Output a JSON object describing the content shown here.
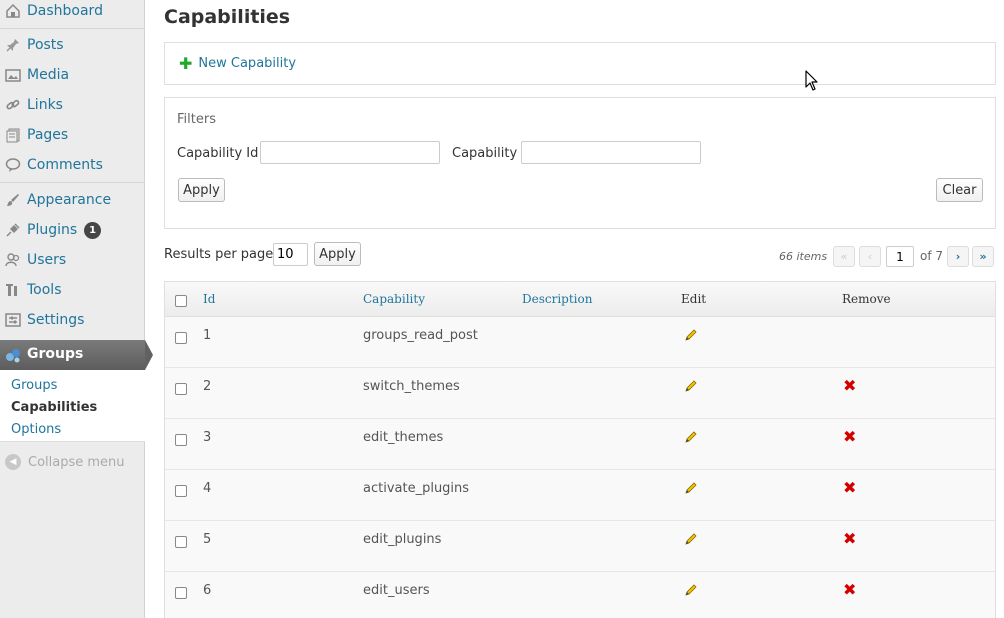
{
  "sidebar": {
    "menu": [
      {
        "key": "dashboard",
        "label": "Dashboard",
        "icon": "dashboard-icon"
      },
      {
        "key": "posts",
        "label": "Posts",
        "icon": "pin-icon"
      },
      {
        "key": "media",
        "label": "Media",
        "icon": "media-icon"
      },
      {
        "key": "links",
        "label": "Links",
        "icon": "link-icon"
      },
      {
        "key": "pages",
        "label": "Pages",
        "icon": "pages-icon"
      },
      {
        "key": "comments",
        "label": "Comments",
        "icon": "comment-bubble-icon"
      },
      {
        "key": "appearance",
        "label": "Appearance",
        "icon": "paintbrush-icon"
      },
      {
        "key": "plugins",
        "label": "Plugins",
        "icon": "plug-icon",
        "badge": "1"
      },
      {
        "key": "users",
        "label": "Users",
        "icon": "users-icon"
      },
      {
        "key": "tools",
        "label": "Tools",
        "icon": "tools-icon"
      },
      {
        "key": "settings",
        "label": "Settings",
        "icon": "settings-icon"
      }
    ],
    "active": {
      "label": "Groups",
      "icon": "groups-icon"
    },
    "submenu": [
      {
        "label": "Groups",
        "current": false
      },
      {
        "label": "Capabilities",
        "current": true
      },
      {
        "label": "Options",
        "current": false
      }
    ],
    "collapse_label": "Collapse menu"
  },
  "main": {
    "title": "Capabilities",
    "new_capability_label": "New Capability",
    "filters": {
      "title": "Filters",
      "capability_id_label": "Capability Id",
      "capability_id_value": "",
      "capability_label": "Capability",
      "capability_value": "",
      "apply_label": "Apply",
      "clear_label": "Clear"
    },
    "results_per_page": {
      "label": "Results per page",
      "value": "10",
      "apply_label": "Apply"
    },
    "pagination": {
      "items_text": "66 items",
      "first": "«",
      "prev": "‹",
      "current_page": "1",
      "of_text": "of 7",
      "next": "›",
      "last": "»"
    },
    "table": {
      "columns": {
        "id": "Id",
        "capability": "Capability",
        "description": "Description",
        "edit": "Edit",
        "remove": "Remove"
      },
      "rows": [
        {
          "id": "1",
          "capability": "groups_read_post",
          "description": "",
          "removable": false
        },
        {
          "id": "2",
          "capability": "switch_themes",
          "description": "",
          "removable": true
        },
        {
          "id": "3",
          "capability": "edit_themes",
          "description": "",
          "removable": true
        },
        {
          "id": "4",
          "capability": "activate_plugins",
          "description": "",
          "removable": true
        },
        {
          "id": "5",
          "capability": "edit_plugins",
          "description": "",
          "removable": true
        },
        {
          "id": "6",
          "capability": "edit_users",
          "description": "",
          "removable": true
        }
      ]
    }
  },
  "colors": {
    "link": "#21759b",
    "add_green": "#1fa82a",
    "remove_red": "#d40000",
    "active_menu": "#616161"
  }
}
